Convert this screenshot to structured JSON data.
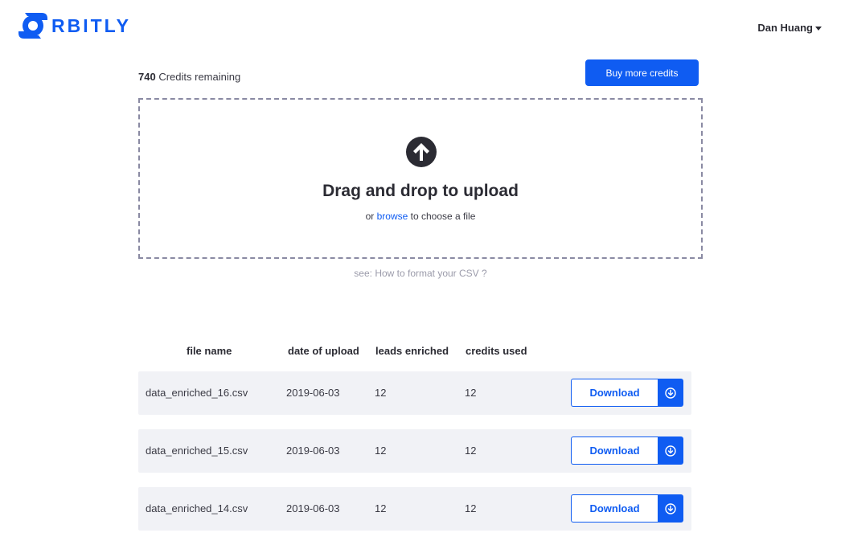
{
  "header": {
    "brand": "RBITLY",
    "user_name": "Dan Huang"
  },
  "credits": {
    "count": "740",
    "label": "Credits remaining",
    "buy_label": "Buy more credits"
  },
  "upload": {
    "title": "Drag and drop to upload",
    "sub_prefix": "or",
    "browse_link": "browse",
    "sub_suffix": "to choose a file",
    "help_prefix": "see:",
    "help_link": "How to format your CSV ?"
  },
  "table": {
    "columns": [
      "file name",
      "date of upload",
      "leads enriched",
      "credits used"
    ],
    "download_label": "Download",
    "rows": [
      {
        "file": "data_enriched_16.csv",
        "date": "2019-06-03",
        "leads": "12",
        "credits": "12"
      },
      {
        "file": "data_enriched_15.csv",
        "date": "2019-06-03",
        "leads": "12",
        "credits": "12"
      },
      {
        "file": "data_enriched_14.csv",
        "date": "2019-06-03",
        "leads": "12",
        "credits": "12"
      }
    ]
  },
  "colors": {
    "accent": "#0f5cf2",
    "text": "#2b2b33",
    "row_bg": "#f1f2f6",
    "dash_border": "#8a8aa3"
  }
}
